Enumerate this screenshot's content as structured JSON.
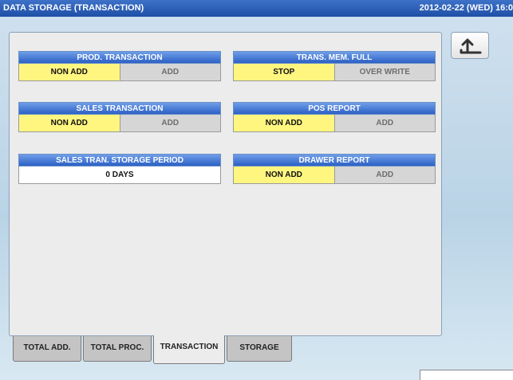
{
  "header": {
    "title": "DATA STORAGE (TRANSACTION)",
    "datetime": "2012-02-22 (WED) 16:0"
  },
  "settings": {
    "prod_transaction": {
      "label": "PROD. TRANSACTION",
      "options": [
        "NON ADD",
        "ADD"
      ],
      "selected": "NON ADD"
    },
    "sales_transaction": {
      "label": "SALES TRANSACTION",
      "options": [
        "NON ADD",
        "ADD"
      ],
      "selected": "NON ADD"
    },
    "storage_period": {
      "label": "SALES TRAN. STORAGE PERIOD",
      "value": "0 DAYS"
    },
    "trans_mem_full": {
      "label": "TRANS. MEM. FULL",
      "options": [
        "STOP",
        "OVER WRITE"
      ],
      "selected": "STOP"
    },
    "pos_report": {
      "label": "POS REPORT",
      "options": [
        "NON ADD",
        "ADD"
      ],
      "selected": "NON ADD"
    },
    "drawer_report": {
      "label": "DRAWER REPORT",
      "options": [
        "NON ADD",
        "ADD"
      ],
      "selected": "NON ADD"
    }
  },
  "tabs": [
    {
      "label": "TOTAL ADD."
    },
    {
      "label": "TOTAL PROC."
    },
    {
      "label": "TRANSACTION",
      "active": true
    },
    {
      "label": "STORAGE"
    }
  ],
  "icons": {
    "back": "return-arrow-icon"
  },
  "colors": {
    "selected": "#fff680",
    "header": "#2c61c5",
    "titlebar": "#1f4fa6"
  }
}
